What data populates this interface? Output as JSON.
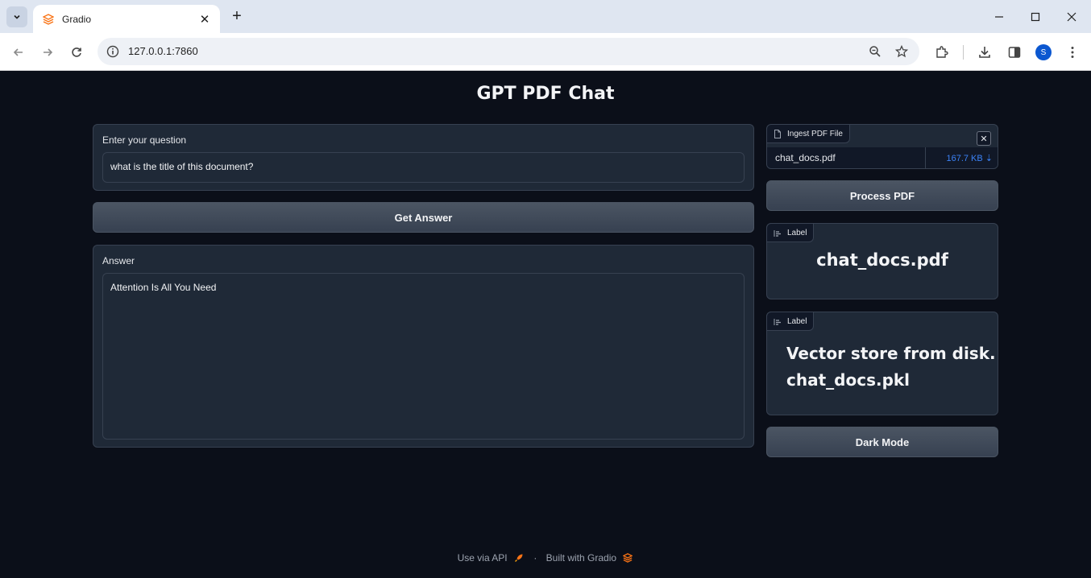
{
  "browser": {
    "tab_title": "Gradio",
    "url": "127.0.0.1:7860",
    "profile_initial": "S"
  },
  "app": {
    "title": "GPT PDF Chat",
    "question": {
      "label": "Enter your question",
      "value": "what is the title of this document?"
    },
    "get_answer_label": "Get Answer",
    "answer": {
      "label": "Answer",
      "value": "Attention Is All You Need"
    },
    "file_upload": {
      "label": "Ingest PDF File",
      "file_name": "chat_docs.pdf",
      "file_size": "167.7 KB ⇣"
    },
    "process_pdf_label": "Process PDF",
    "label_1": {
      "tag": "Label",
      "value": "chat_docs.pdf"
    },
    "label_2": {
      "tag": "Label",
      "value_line1": "Vector store from disk.",
      "value_line2": "chat_docs.pkl"
    },
    "dark_mode_label": "Dark Mode"
  },
  "footer": {
    "api_text": "Use via API",
    "separator": "·",
    "built_text": "Built with Gradio"
  },
  "colors": {
    "background": "#0b0f19",
    "panel": "#1f2937",
    "border": "#374151",
    "link": "#3b82f6",
    "gradio_orange": "#f97316"
  }
}
